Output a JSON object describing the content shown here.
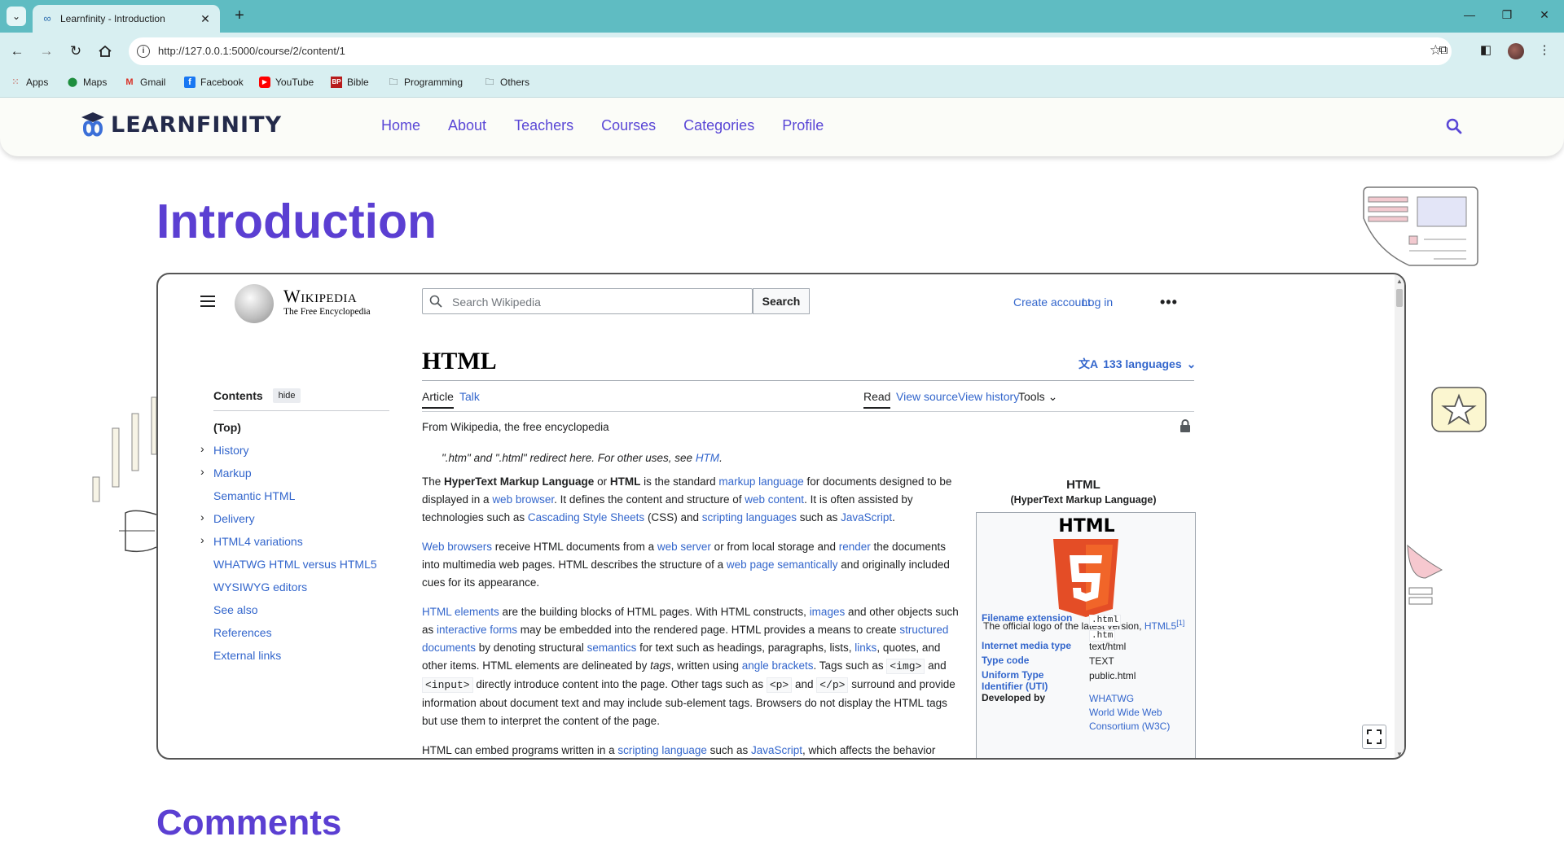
{
  "browser": {
    "tab_title": "Learnfinity - Introduction",
    "url": "http://127.0.0.1:5000/course/2/content/1",
    "bookmarks": [
      "Apps",
      "Maps",
      "Gmail",
      "Facebook",
      "YouTube",
      "Bible",
      "Programming",
      "Others"
    ]
  },
  "site": {
    "logo_text": "LEARNFINITY",
    "nav": [
      "Home",
      "About",
      "Teachers",
      "Courses",
      "Categories",
      "Profile"
    ],
    "page_title": "Introduction",
    "comments_title": "Comments"
  },
  "wiki": {
    "wordmark": "Wikipedia",
    "tagline": "The Free Encyclopedia",
    "search_placeholder": "Search Wikipedia",
    "search_button": "Search",
    "create_account": "Create account",
    "log_in": "Log in",
    "more": "•••",
    "toc_title": "Contents",
    "toc_hide": "hide",
    "toc": [
      {
        "label": "(Top)",
        "chevron": false
      },
      {
        "label": "History",
        "chevron": true
      },
      {
        "label": "Markup",
        "chevron": true
      },
      {
        "label": "Semantic HTML",
        "chevron": false
      },
      {
        "label": "Delivery",
        "chevron": true
      },
      {
        "label": "HTML4 variations",
        "chevron": true
      },
      {
        "label": "WHATWG HTML versus HTML5",
        "chevron": false
      },
      {
        "label": "WYSIWYG editors",
        "chevron": false
      },
      {
        "label": "See also",
        "chevron": false
      },
      {
        "label": "References",
        "chevron": false
      },
      {
        "label": "External links",
        "chevron": false
      }
    ],
    "title": "HTML",
    "languages": "133 languages",
    "tabs_left": [
      "Article",
      "Talk"
    ],
    "tabs_right": [
      "Read",
      "View source",
      "View history",
      "Tools"
    ],
    "from": "From Wikipedia, the free encyclopedia",
    "hatnote_text": "\".htm\" and \".html\" redirect here. For other uses, see ",
    "hatnote_link": "HTM",
    "hatnote_end": ".",
    "infobox": {
      "title": "HTML",
      "subtitle": "(HyperText Markup Language)",
      "logo_word": "HTML",
      "caption_text": "The official logo of the latest version, ",
      "caption_link": "HTML5",
      "caption_ref": "[1]",
      "rows": [
        {
          "key": "Filename extension",
          "values": [
            ".html",
            ".htm"
          ],
          "code": true,
          "link_key": true
        },
        {
          "key": "Internet media type",
          "values": [
            "text/html"
          ],
          "code": false,
          "link_key": true
        },
        {
          "key": "Type code",
          "values": [
            "TEXT"
          ],
          "code": false,
          "link_key": true
        },
        {
          "key": "Uniform Type Identifier (UTI)",
          "values": [
            "public.html"
          ],
          "code": false,
          "link_key": true
        },
        {
          "key": "Developed by",
          "values": [
            "WHATWG",
            "World Wide Web Consortium (W3C)"
          ],
          "code": false,
          "link_key": false
        }
      ]
    }
  },
  "colors": {
    "chrome_top": "#5fbcc2",
    "chrome_toolbar": "#d8eff1",
    "site_accent": "#5b3fd2",
    "wiki_link": "#3366cc",
    "html5_orange": "#e44d26"
  }
}
